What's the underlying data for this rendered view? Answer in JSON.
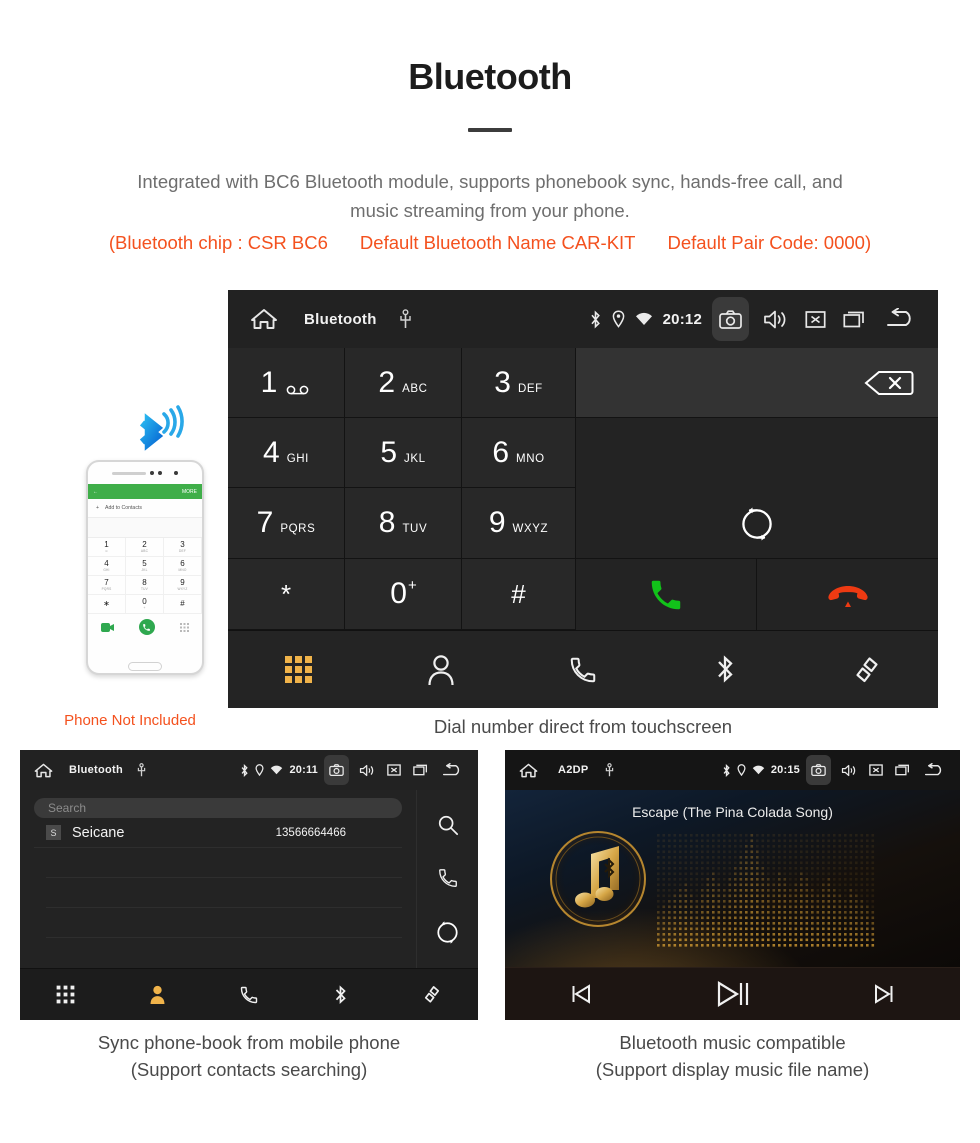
{
  "header": {
    "title": "Bluetooth",
    "description_line1": "Integrated with BC6 Bluetooth module, supports phonebook sync, hands-free call, and",
    "description_line2": "music streaming from your phone.",
    "note_chip": "(Bluetooth chip : CSR BC6",
    "note_name": "Default Bluetooth Name CAR-KIT",
    "note_pair": "Default Pair Code: 0000)",
    "accent_color": "#f4511e",
    "text_color": "#6e6e6e"
  },
  "dialer": {
    "statusbar": {
      "title": "Bluetooth",
      "time": "20:12",
      "icons": [
        "home-icon",
        "usb-icon",
        "bluetooth-icon",
        "location-icon",
        "wifi-icon",
        "camera-icon",
        "volume-icon",
        "close-box-icon",
        "recents-icon",
        "back-icon"
      ]
    },
    "keys": [
      {
        "digit": "1",
        "sub": "",
        "voicemail": true
      },
      {
        "digit": "2",
        "sub": "ABC"
      },
      {
        "digit": "3",
        "sub": "DEF"
      },
      {
        "digit": "4",
        "sub": "GHI"
      },
      {
        "digit": "5",
        "sub": "JKL"
      },
      {
        "digit": "6",
        "sub": "MNO"
      },
      {
        "digit": "7",
        "sub": "PQRS"
      },
      {
        "digit": "8",
        "sub": "TUV"
      },
      {
        "digit": "9",
        "sub": "WXYZ"
      },
      {
        "digit": "*",
        "sub": ""
      },
      {
        "digit": "0",
        "sup": "+"
      },
      {
        "digit": "#",
        "sub": ""
      }
    ],
    "number_value": "",
    "backspace_label": "backspace-icon",
    "call_color": "#12c21a",
    "hangup_color": "#ee3a12",
    "nav": [
      {
        "name": "keypad",
        "active": true
      },
      {
        "name": "contacts",
        "active": false
      },
      {
        "name": "call-log",
        "active": false
      },
      {
        "name": "bluetooth",
        "active": false
      },
      {
        "name": "link",
        "active": false
      }
    ],
    "nav_active_color": "#f0b34a",
    "caption": "Dial number direct from touchscreen"
  },
  "phone_illustration": {
    "header_back": "←",
    "header_more": "MORE",
    "add_contacts": "Add to Contacts",
    "keys": [
      {
        "n": "1",
        "s": "∞"
      },
      {
        "n": "2",
        "s": "ABC"
      },
      {
        "n": "3",
        "s": "DEF"
      },
      {
        "n": "4",
        "s": "GHI"
      },
      {
        "n": "5",
        "s": "JKL"
      },
      {
        "n": "6",
        "s": "MNO"
      },
      {
        "n": "7",
        "s": "PQRS"
      },
      {
        "n": "8",
        "s": "TUV"
      },
      {
        "n": "9",
        "s": "WXYZ"
      },
      {
        "n": "∗",
        "s": ""
      },
      {
        "n": "0",
        "s": "+"
      },
      {
        "n": "#",
        "s": ""
      }
    ],
    "not_included": "Phone Not Included",
    "bluetooth_color": "#1e9ae0"
  },
  "contacts_screen": {
    "statusbar": {
      "title": "Bluetooth",
      "time": "20:11"
    },
    "search_placeholder": "Search",
    "rows": [
      {
        "badge": "S",
        "name": "Seicane",
        "number": "13566664466"
      }
    ],
    "empty_rows": 4,
    "side_actions": [
      "search-icon",
      "call-icon",
      "sync-icon"
    ],
    "nav": [
      {
        "name": "keypad",
        "active": false
      },
      {
        "name": "contacts",
        "active": true
      },
      {
        "name": "call-log",
        "active": false
      },
      {
        "name": "bluetooth",
        "active": false
      },
      {
        "name": "link",
        "active": false
      }
    ],
    "caption_line1": "Sync phone-book from mobile phone",
    "caption_line2": "(Support contacts searching)"
  },
  "a2dp_screen": {
    "statusbar": {
      "title": "A2DP",
      "time": "20:15"
    },
    "song_title": "Escape (The Pina Colada Song)",
    "controls": [
      "previous-track",
      "play-pause",
      "next-track"
    ],
    "accent_color": "#d39c33",
    "caption_line1": "Bluetooth music compatible",
    "caption_line2": "(Support display music file name)"
  }
}
